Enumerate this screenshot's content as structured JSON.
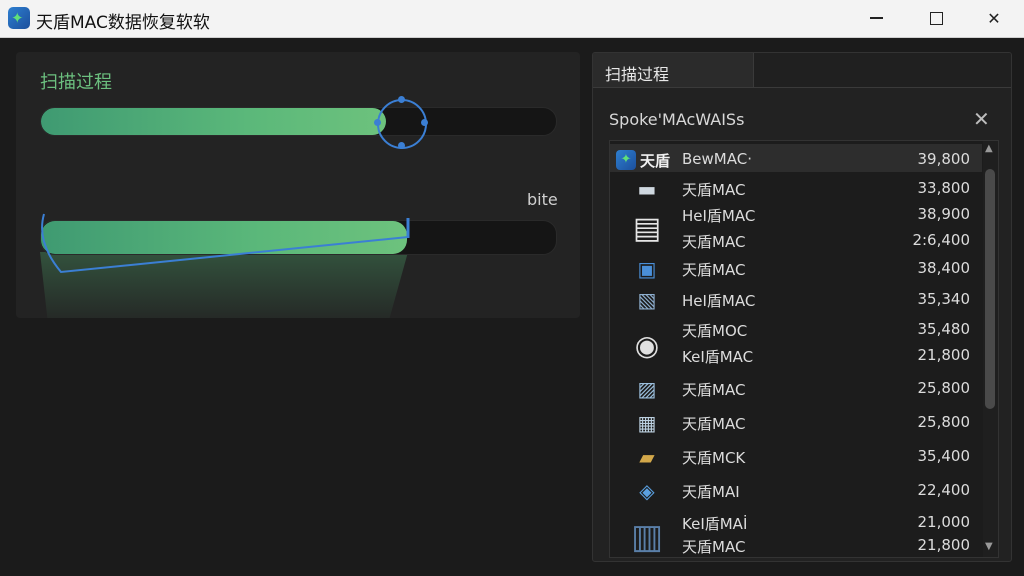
{
  "window": {
    "title": "天盾MAC数据恢复软软",
    "controls": {
      "minimize_icon": "minimize-icon",
      "maximize_icon": "maximize-icon",
      "close_icon": "close-icon",
      "close_glyph": "✕"
    }
  },
  "left_panel": {
    "title": "扫描过程",
    "progress1": 0.67,
    "progress2": 0.71,
    "side_label": "bite"
  },
  "right_panel": {
    "header_title": "扫描过程",
    "subheader": "Spoke'MAcWAISs",
    "close_glyph": "✕",
    "rows": [
      {
        "brand": "天盾",
        "name": "BewMAC·",
        "size": "39,800",
        "icon": "app-logo-icon"
      },
      {
        "name": "天盾MAC",
        "size": "33,800",
        "icon": "drive-icon",
        "glyph": "▬"
      },
      {
        "name": "HeI盾MAC",
        "size": "38,900",
        "icon": "document-icon",
        "glyph": "▤"
      },
      {
        "name": "天盾MAC",
        "size": "2:6,400",
        "icon": "document-icon",
        "glyph": ""
      },
      {
        "name": "天盾MAC",
        "size": "38,400",
        "icon": "monitor-icon",
        "glyph": "▣"
      },
      {
        "name": "HeI盾MAC",
        "size": "35,340",
        "icon": "image-icon",
        "glyph": "▧"
      },
      {
        "name": "天盾MOC",
        "size": "35,480",
        "icon": "disc-file-icon",
        "glyph": "◉"
      },
      {
        "name": "KeI盾MAC",
        "size": "21,800",
        "icon": "disc-file-icon",
        "glyph": ""
      },
      {
        "name": "天盾MAC",
        "size": "25,800",
        "icon": "image-icon",
        "glyph": "▨"
      },
      {
        "name": "天盾MAC",
        "size": "25,800",
        "icon": "chart-file-icon",
        "glyph": "▦"
      },
      {
        "name": "天盾MCK",
        "size": "35,400",
        "icon": "folder-icon",
        "glyph": "▰"
      },
      {
        "name": "天盾MAI",
        "size": "22,400",
        "icon": "water-drop-icon",
        "glyph": "◈"
      },
      {
        "name": "KeI盾MAİ",
        "size": "21,000",
        "icon": "tablet-icon",
        "glyph": "▥"
      },
      {
        "name": "天盾MAC",
        "size": "21,800",
        "icon": "tablet-icon",
        "glyph": ""
      }
    ],
    "scroll_up": "▲",
    "scroll_down": "▼"
  }
}
